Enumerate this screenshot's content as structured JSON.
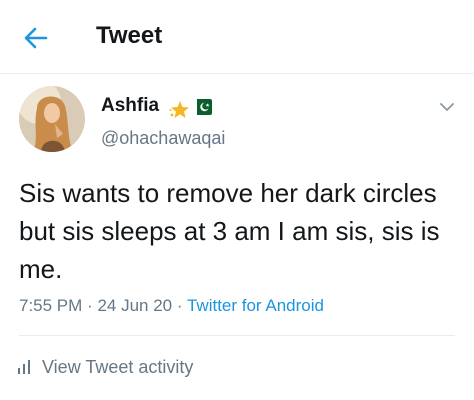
{
  "header": {
    "title": "Tweet",
    "back_icon": "arrow-left-icon"
  },
  "tweet": {
    "display_name": "Ashfia",
    "name_emojis": [
      "star-emoji",
      "pakistan-flag-emoji"
    ],
    "handle": "@ohachawaqai",
    "text": "Sis wants to remove her dark circles but sis sleeps at 3 am I am sis, sis is me.",
    "time": "7:55 PM",
    "date": "24 Jun 20",
    "separator": "·",
    "source": "Twitter for Android",
    "caret_icon": "chevron-down-icon"
  },
  "activity": {
    "icon": "bar-chart-icon",
    "label": "View Tweet activity"
  },
  "colors": {
    "accent": "#1b95e0",
    "secondary_text": "#657786",
    "primary_text": "#14171a",
    "divider": "#e6ecf0"
  }
}
